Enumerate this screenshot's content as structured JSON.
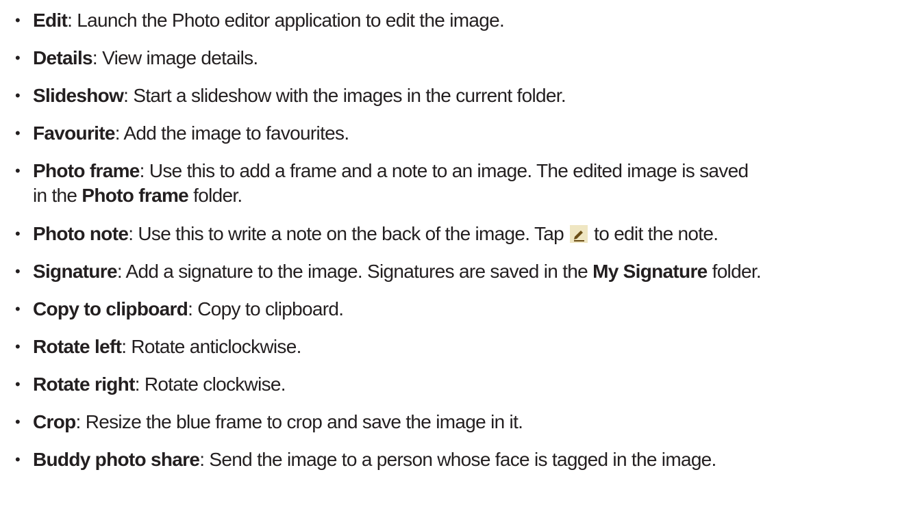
{
  "items": [
    {
      "term": "Edit",
      "sep": ": ",
      "text": "Launch the Photo editor application to edit the image."
    },
    {
      "term": "Details",
      "sep": ": ",
      "text": "View image details."
    },
    {
      "term": "Slideshow",
      "sep": ": ",
      "text": "Start a slideshow with the images in the current folder."
    },
    {
      "term": "Favourite",
      "sep": ": ",
      "text": "Add the image to favourites."
    },
    {
      "term": "Photo frame",
      "sep": ": ",
      "text": "Use this to add a frame and a note to an image. The edited image is saved",
      "line2_pre": "in the ",
      "line2_bold": "Photo frame",
      "line2_post": " folder."
    },
    {
      "term": "Photo note",
      "sep": ": ",
      "text_pre": "Use this to write a note on the back of the image. Tap ",
      "icon": "edit-pencil-icon",
      "text_post": " to edit the note."
    },
    {
      "term": "Signature",
      "sep": ": ",
      "text_pre": "Add a signature to the image. Signatures are saved in the ",
      "bold": "My Signature",
      "text_post": " folder."
    },
    {
      "term": "Copy to clipboard",
      "sep": ": ",
      "text": "Copy to clipboard."
    },
    {
      "term": "Rotate left",
      "sep": ": ",
      "text": "Rotate anticlockwise."
    },
    {
      "term": "Rotate right",
      "sep": ": ",
      "text": "Rotate clockwise."
    },
    {
      "term": "Crop",
      "sep": ": ",
      "text": "Resize the blue frame to crop and save the image in it."
    },
    {
      "term": "Buddy photo share",
      "sep": ": ",
      "text": "Send the image to a person whose face is tagged in the image."
    }
  ],
  "bullet_char": "•",
  "colors": {
    "text": "#231f20",
    "icon_bg": "#efe6c2",
    "icon_fg": "#6b4e16"
  }
}
